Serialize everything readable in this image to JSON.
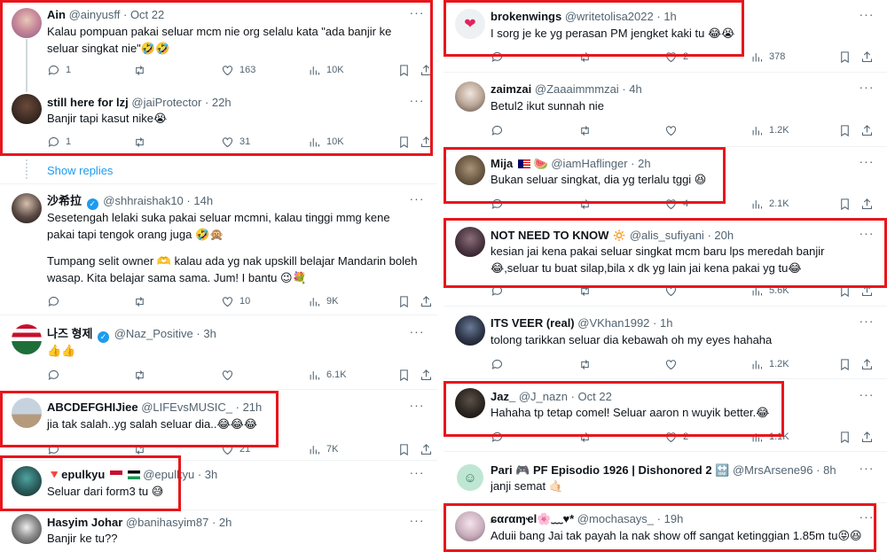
{
  "colors": {
    "accent": "#1d9bf0",
    "highlight_box": "#e8161c",
    "muted": "#536471",
    "text": "#0f1419"
  },
  "left": {
    "tweets": [
      {
        "name": "Ain",
        "handle": "@ainyusff",
        "time": "Oct 22",
        "text": "Kalau pompuan pakai seluar mcm nie org selalu kata \"ada banjir ke seluar singkat nie\"🤣🤣",
        "replies": "1",
        "retweets": "",
        "likes": "163",
        "views": "10K"
      },
      {
        "name": "still here for lzj",
        "handle": "@jaiProtector",
        "time": "22h",
        "text": "Banjir tapi kasut nike😭",
        "replies": "1",
        "retweets": "",
        "likes": "31",
        "views": "10K"
      },
      {
        "name": "沙希拉",
        "handle": "@shhraishak10",
        "time": "14h",
        "text1": "Sesetengah lelaki suka pakai seluar mcmni, kalau tinggi mmg kene pakai tapi tengok orang juga 🤣🙊",
        "text2": "Tumpang selit owner 🫶 kalau ada yg nak upskill belajar Mandarin boleh wasap. Kita belajar sama sama. Jum! I bantu 😉💐",
        "replies": "",
        "retweets": "",
        "likes": "10",
        "views": "9K"
      },
      {
        "name": "나즈 형제",
        "handle": "@Naz_Positive",
        "time": "3h",
        "text": "👍👍",
        "replies": "",
        "retweets": "",
        "likes": "",
        "views": "6.1K"
      },
      {
        "name": "ABCDEFGHIJiee",
        "handle": "@LIFEvsMUSIC_",
        "time": "21h",
        "text": "jia tak salah..yg salah seluar dia..😂😂😂",
        "replies": "",
        "retweets": "",
        "likes": "21",
        "views": "7K"
      },
      {
        "name": "🔻epulkyu",
        "handle": "@epulkyu",
        "time": "3h",
        "text": "Seluar dari form3 tu 😅"
      },
      {
        "name": "Hasyim Johar",
        "handle": "@banihasyim87",
        "time": "2h",
        "text": "Banjir ke tu??"
      }
    ],
    "show_replies": "Show replies"
  },
  "right": {
    "tweets": [
      {
        "name": "brokenwings",
        "handle": "@writetolisa2022",
        "time": "1h",
        "text": "I sorg je ke yg perasan PM jengket kaki tu 😂😭",
        "replies": "",
        "retweets": "",
        "likes": "2",
        "views": "378"
      },
      {
        "name": "zaimzai",
        "handle": "@Zaaaimmmzai",
        "time": "4h",
        "text": "Betul2 ikut sunnah nie",
        "replies": "",
        "retweets": "",
        "likes": "",
        "views": "1.2K"
      },
      {
        "name": "Mija",
        "handle": "@iamHaflinger",
        "time": "2h",
        "text": "Bukan seluar singkat, dia yg terlalu tggi 😆",
        "replies": "",
        "retweets": "",
        "likes": "4",
        "views": "2.1K"
      },
      {
        "name": "NOT NEED TO KNOW",
        "handle": "@alis_sufiyani",
        "time": "20h",
        "text": "kesian jai kena pakai seluar singkat mcm baru lps meredah banjir😂,seluar tu buat silap,bila x dk yg lain jai kena pakai yg tu😂",
        "replies": "",
        "retweets": "",
        "likes": "",
        "views": "5.6K"
      },
      {
        "name": "ITS VEER (real)",
        "handle": "@VKhan1992",
        "time": "1h",
        "text": "tolong tarikkan seluar dia kebawah oh my eyes hahaha",
        "replies": "",
        "retweets": "",
        "likes": "",
        "views": "1.2K"
      },
      {
        "name": "Jaz_",
        "handle": "@J_nazn",
        "time": "Oct 22",
        "text": "Hahaha tp tetap comel! Seluar aaron n wuyik better.😂",
        "replies": "",
        "retweets": "",
        "likes": "2",
        "views": "1.1K"
      },
      {
        "name": "Pari 🎮 PF Episodio 1926 | Dishonored 2 🔛",
        "handle": "@MrsArsene96",
        "time": "8h",
        "text": "janji semat 🤙🏻"
      },
      {
        "name": "ɕαɾαɱҽl🌸﹏♥︎*",
        "handle": "@mochasays_",
        "time": "19h",
        "text": "Aduii bang Jai tak payah la nak show off sangat ketinggian 1.85m tu😝😆"
      }
    ]
  }
}
